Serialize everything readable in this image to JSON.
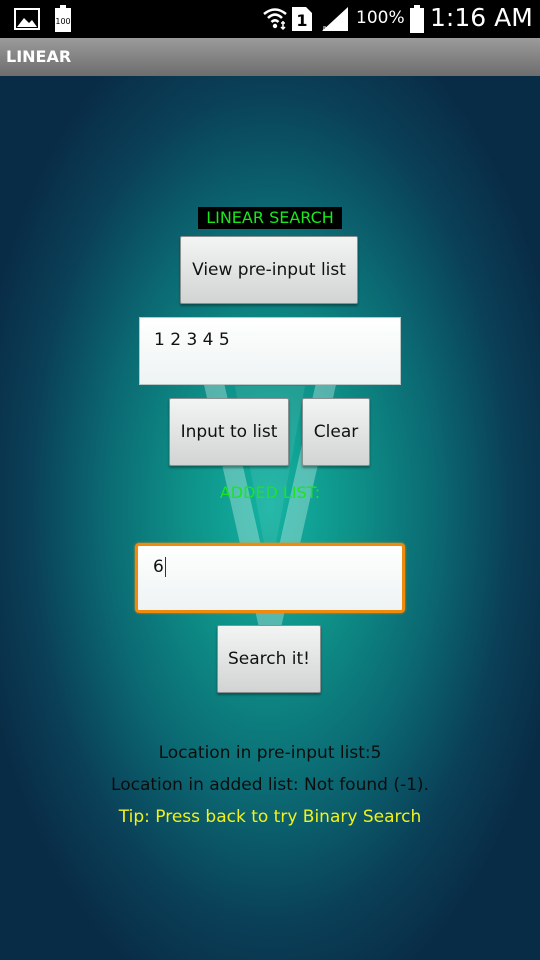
{
  "status_bar": {
    "battery_badge": "100",
    "sim_badge": "1",
    "battery_percent": "100%",
    "time": "1:16 AM",
    "icons": [
      "image-icon",
      "battery-saver-icon",
      "wifi-icon",
      "sim-icon",
      "signal-icon",
      "battery-icon"
    ]
  },
  "action_bar": {
    "title": "LINEAR"
  },
  "main": {
    "heading": "LINEAR SEARCH",
    "view_button": "View pre-input list",
    "list_input_value": "1 2 3 4 5",
    "input_to_list_button": "Input to list",
    "clear_button": "Clear",
    "added_list_label": "ADDED LIST:",
    "search_input_value": "6",
    "search_button": "Search it!",
    "result_pre_input": "Location in pre-input list:5",
    "result_added": "Location in added list: Not found (-1).",
    "tip": "Tip: Press back to try Binary Search"
  },
  "colors": {
    "heading_text": "#18e81c",
    "added_label": "#19e61d",
    "tip_text": "#f2f21a",
    "focus_border": "#f08a0c",
    "action_bar": "#8a8a8a"
  }
}
